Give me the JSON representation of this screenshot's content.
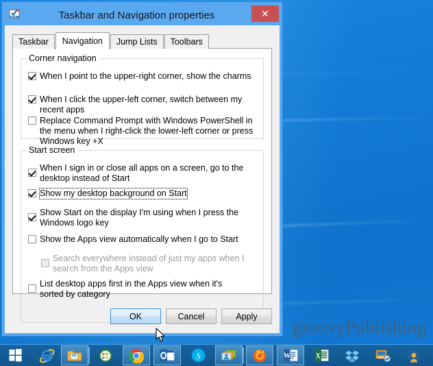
{
  "desktop": {
    "watermark": "groovyPublishing"
  },
  "dialog": {
    "title": "Taskbar and Navigation properties",
    "title_icon": "taskbar-properties-icon",
    "close_label": "✕",
    "close_icon": "close-icon",
    "tabs": [
      {
        "label": "Taskbar",
        "active": false
      },
      {
        "label": "Navigation",
        "active": true
      },
      {
        "label": "Jump Lists",
        "active": false
      },
      {
        "label": "Toolbars",
        "active": false
      }
    ],
    "groups": [
      {
        "legend": "Corner navigation",
        "options": [
          {
            "label": "When I point to the upper-right corner, show the charms",
            "checked": true,
            "enabled": true,
            "focused": false
          },
          {
            "label": "When I click the upper-left corner, switch between my recent apps",
            "checked": true,
            "enabled": true,
            "focused": false
          },
          {
            "label": "Replace Command Prompt with Windows PowerShell in the menu when I right-click the lower-left corner or press Windows key +X",
            "checked": false,
            "enabled": true,
            "focused": false
          }
        ]
      },
      {
        "legend": "Start screen",
        "options": [
          {
            "label": "When I sign in or close all apps on a screen, go to the desktop instead of Start",
            "checked": true,
            "enabled": true,
            "focused": false
          },
          {
            "label": "Show my desktop background on Start",
            "checked": true,
            "enabled": true,
            "focused": true
          },
          {
            "label": "Show Start on the display I'm using when I press the Windows logo key",
            "checked": true,
            "enabled": true,
            "focused": false
          },
          {
            "label": "Show the Apps view automatically when I go to Start",
            "checked": false,
            "enabled": true,
            "focused": false
          },
          {
            "label": "Search everywhere instead of just my apps when I search from the Apps view",
            "checked": false,
            "enabled": false,
            "focused": false
          },
          {
            "label": "List desktop apps first in the Apps view when it's sorted by category",
            "checked": false,
            "enabled": true,
            "focused": false
          }
        ]
      }
    ],
    "buttons": [
      {
        "label": "OK",
        "primary": true
      },
      {
        "label": "Cancel",
        "primary": false
      },
      {
        "label": "Apply",
        "primary": false
      }
    ]
  },
  "taskbar": {
    "start_icon": "windows-start-icon",
    "items": [
      {
        "icon": "internet-explorer-icon",
        "pinned": false,
        "multi": false
      },
      {
        "icon": "file-explorer-icon",
        "pinned": true,
        "multi": true
      },
      {
        "icon": "windows-media-player-icon",
        "pinned": false,
        "multi": false
      },
      {
        "icon": "google-chrome-icon",
        "pinned": true,
        "multi": false
      },
      {
        "icon": "microsoft-outlook-icon",
        "pinned": true,
        "multi": false
      },
      {
        "icon": "skype-icon",
        "pinned": false,
        "multi": false
      },
      {
        "icon": "remote-desktop-icon",
        "pinned": true,
        "multi": true
      },
      {
        "icon": "mozilla-firefox-icon",
        "pinned": true,
        "multi": false
      },
      {
        "icon": "microsoft-word-icon",
        "pinned": true,
        "multi": false
      },
      {
        "icon": "microsoft-excel-icon",
        "pinned": false,
        "multi": false
      },
      {
        "icon": "dropbox-icon",
        "pinned": false,
        "multi": false
      },
      {
        "icon": "paint-tool-icon",
        "pinned": false,
        "multi": false
      },
      {
        "icon": "headphones-user-icon",
        "pinned": false,
        "multi": false
      }
    ]
  },
  "colors": {
    "window_frame": "#5aa9f0",
    "close_button": "#c75050",
    "dialog_face": "#f0f0f0",
    "accent_blue": "#1479d1",
    "taskbar": "#15629f"
  }
}
